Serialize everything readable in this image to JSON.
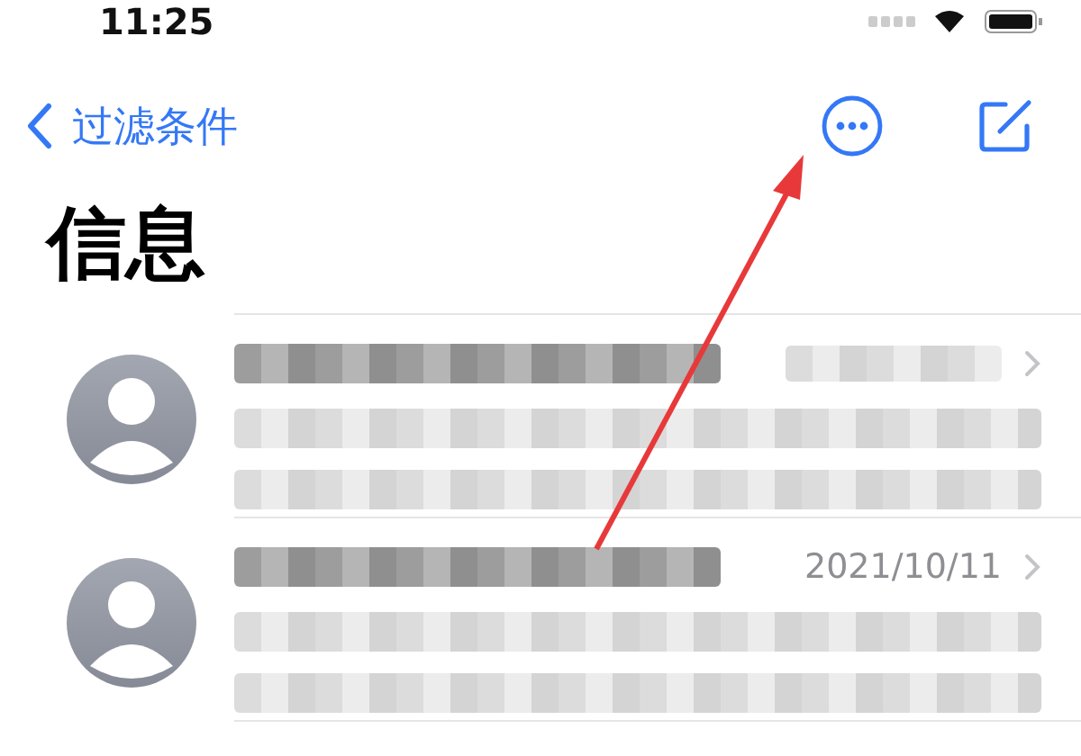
{
  "status_bar": {
    "time": "11:25"
  },
  "nav": {
    "back_label": "过滤条件"
  },
  "title": "信息",
  "conversations": [
    {
      "date_redacted": true
    },
    {
      "date": "2021/10/11",
      "date_redacted": false
    }
  ]
}
